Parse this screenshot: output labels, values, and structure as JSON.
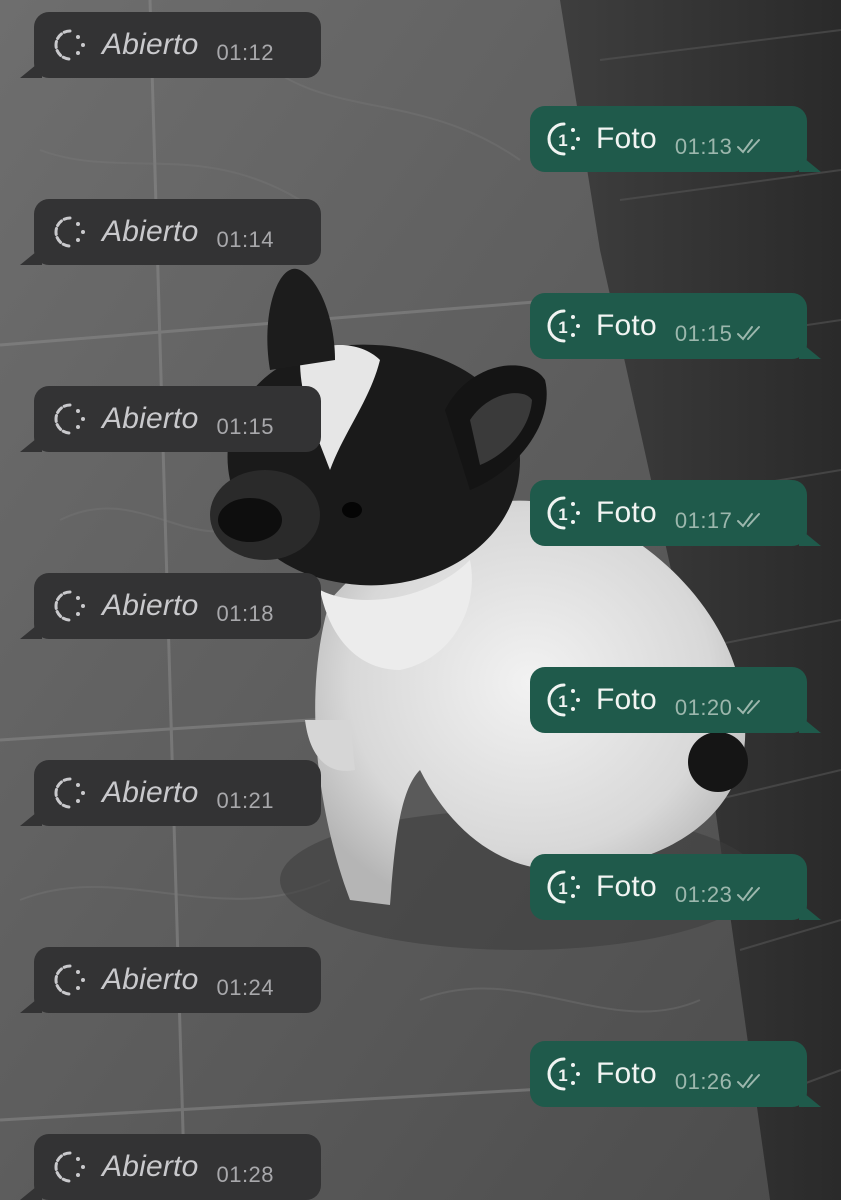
{
  "messages": [
    {
      "direction": "in",
      "label": "Abierto",
      "time": "01:12",
      "icon": "view-once-open-icon"
    },
    {
      "direction": "out",
      "label": "Foto",
      "time": "01:13",
      "icon": "view-once-photo-icon",
      "status": "read-double-check"
    },
    {
      "direction": "in",
      "label": "Abierto",
      "time": "01:14",
      "icon": "view-once-open-icon"
    },
    {
      "direction": "out",
      "label": "Foto",
      "time": "01:15",
      "icon": "view-once-photo-icon",
      "status": "read-double-check"
    },
    {
      "direction": "in",
      "label": "Abierto",
      "time": "01:15",
      "icon": "view-once-open-icon"
    },
    {
      "direction": "out",
      "label": "Foto",
      "time": "01:17",
      "icon": "view-once-photo-icon",
      "status": "read-double-check"
    },
    {
      "direction": "in",
      "label": "Abierto",
      "time": "01:18",
      "icon": "view-once-open-icon"
    },
    {
      "direction": "out",
      "label": "Foto",
      "time": "01:20",
      "icon": "view-once-photo-icon",
      "status": "read-double-check"
    },
    {
      "direction": "in",
      "label": "Abierto",
      "time": "01:21",
      "icon": "view-once-open-icon"
    },
    {
      "direction": "out",
      "label": "Foto",
      "time": "01:23",
      "icon": "view-once-photo-icon",
      "status": "read-double-check"
    },
    {
      "direction": "in",
      "label": "Abierto",
      "time": "01:24",
      "icon": "view-once-open-icon"
    },
    {
      "direction": "out",
      "label": "Foto",
      "time": "01:26",
      "icon": "view-once-photo-icon",
      "status": "read-double-check"
    },
    {
      "direction": "in",
      "label": "Abierto",
      "time": "01:28",
      "icon": "view-once-open-icon"
    }
  ],
  "colors": {
    "incoming_bubble": "#333334",
    "outgoing_bubble": "#1f5a4b",
    "incoming_text": "#c9c9cc",
    "outgoing_text": "#f1f4f2"
  },
  "background": "grayscale photo of a French bulldog sitting on a tiled floor"
}
